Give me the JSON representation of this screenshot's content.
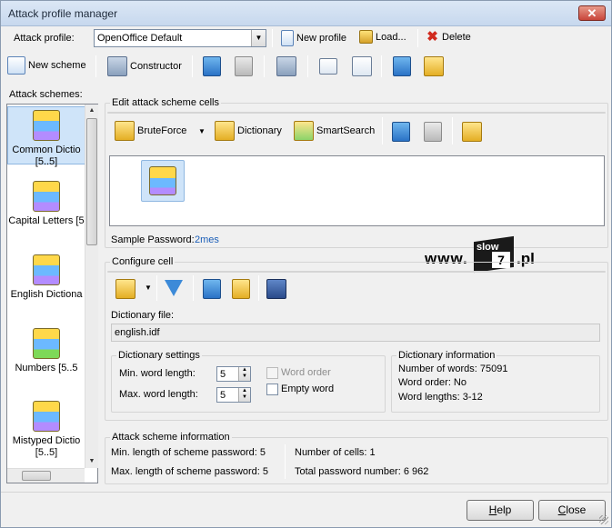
{
  "window": {
    "title": "Attack profile manager",
    "close_glyph": "✕"
  },
  "profile_bar": {
    "label": "Attack profile:",
    "selected": "OpenOffice Default",
    "new_profile": "New profile",
    "load": "Load...",
    "delete": "Delete"
  },
  "toolbar": {
    "new_scheme": "New scheme",
    "constructor": "Constructor",
    "icons": [
      "copy-icon",
      "paste-icon",
      "delete-scheme-icon",
      "import-icon",
      "document-icon",
      "book-icon",
      "edit-icon"
    ]
  },
  "schemes": {
    "label": "Attack schemes:",
    "items": [
      {
        "label": "Common Dictio\n[5..5]",
        "selected": true
      },
      {
        "label": "Capital Letters [5",
        "selected": false
      },
      {
        "label": "English Dictiona",
        "selected": false
      },
      {
        "label": "Numbers [5..5",
        "selected": false
      },
      {
        "label": "Mistyped Dictio\n[5..5]",
        "selected": false
      }
    ]
  },
  "edit_cells": {
    "title": "Edit attack scheme cells",
    "bruteforce": "BruteForce",
    "dictionary": "Dictionary",
    "smartsearch": "SmartSearch",
    "sample_label": "Sample Password:",
    "sample_value": "2mes"
  },
  "watermark": {
    "www": "www.",
    "slow": "slow",
    "seven": "7",
    "pl": ".pl"
  },
  "configure": {
    "title": "Configure cell",
    "dict_file_label": "Dictionary file:",
    "dict_file_value": "english.idf",
    "settings": {
      "title": "Dictionary settings",
      "min_label": "Min. word length:",
      "min_value": "5",
      "max_label": "Max. word length:",
      "max_value": "5",
      "word_order": "Word order",
      "empty_word": "Empty word"
    },
    "info": {
      "title": "Dictionary information",
      "words": "Number of words: 75091",
      "order": "Word order: No",
      "lengths": "Word lengths: 3-12"
    }
  },
  "scheme_info": {
    "title": "Attack scheme information",
    "min_len": "Min. length of scheme password: 5",
    "max_len": "Max. length of scheme password: 5",
    "cells": "Number of cells: 1",
    "total": "Total password number: 6 962"
  },
  "footer": {
    "help_first": "H",
    "help_rest": "elp",
    "close_first": "C",
    "close_rest": "lose"
  }
}
